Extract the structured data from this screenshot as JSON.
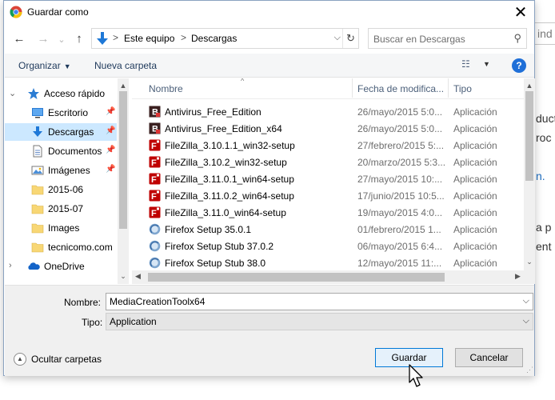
{
  "background": {
    "search_fragment": "ind",
    "text_lines": [
      "duct",
      "roc",
      "n.",
      "a p",
      "ent"
    ]
  },
  "dialog": {
    "title": "Guardar como",
    "close_glyph": "✕"
  },
  "nav": {
    "back_glyph": "←",
    "forward_glyph": "→",
    "up_glyph": "↑",
    "breadcrumbs": [
      "Este equipo",
      "Descargas"
    ],
    "breadcrumb_separator": ">",
    "address_dropdown_glyph": "⌵",
    "refresh_glyph": "↻",
    "search_placeholder": "Buscar en Descargas",
    "search_icon_glyph": "⚲"
  },
  "commandbar": {
    "organize_label": "Organizar",
    "new_folder_label": "Nueva carpeta",
    "view_glyph": "☷",
    "help_label": "?"
  },
  "navpane": {
    "items": [
      {
        "label": "Acceso rápido",
        "icon": "star-icon",
        "expander": "⌄",
        "pinned": false,
        "selected": false
      },
      {
        "label": "Escritorio",
        "icon": "desktop-icon",
        "expander": "",
        "pinned": true,
        "selected": false
      },
      {
        "label": "Descargas",
        "icon": "download-icon",
        "expander": "",
        "pinned": true,
        "selected": true
      },
      {
        "label": "Documentos",
        "icon": "documents-icon",
        "expander": "",
        "pinned": true,
        "selected": false
      },
      {
        "label": "Imágenes",
        "icon": "pictures-icon",
        "expander": "",
        "pinned": true,
        "selected": false
      },
      {
        "label": "2015-06",
        "icon": "folder-icon",
        "expander": "",
        "pinned": false,
        "selected": false
      },
      {
        "label": "2015-07",
        "icon": "folder-icon",
        "expander": "",
        "pinned": false,
        "selected": false
      },
      {
        "label": "Images",
        "icon": "folder-icon",
        "expander": "",
        "pinned": false,
        "selected": false
      },
      {
        "label": "tecnicomo.com",
        "icon": "folder-icon",
        "expander": "",
        "pinned": false,
        "selected": false
      },
      {
        "label": "OneDrive",
        "icon": "onedrive-icon",
        "expander": "›",
        "pinned": false,
        "selected": false
      }
    ]
  },
  "filelist": {
    "columns": [
      "Nombre",
      "Fecha de modifica...",
      "Tipo"
    ],
    "rows": [
      {
        "name": "Antivirus_Free_Edition",
        "date": "26/mayo/2015 5:0...",
        "type": "Aplicación",
        "icon": "antivirus-app-icon"
      },
      {
        "name": "Antivirus_Free_Edition_x64",
        "date": "26/mayo/2015 5:0...",
        "type": "Aplicación",
        "icon": "antivirus-app-icon"
      },
      {
        "name": "FileZilla_3.10.1.1_win32-setup",
        "date": "27/febrero/2015 5:...",
        "type": "Aplicación",
        "icon": "filezilla-icon"
      },
      {
        "name": "FileZilla_3.10.2_win32-setup",
        "date": "20/marzo/2015 5:3...",
        "type": "Aplicación",
        "icon": "filezilla-icon"
      },
      {
        "name": "FileZilla_3.11.0.1_win64-setup",
        "date": "27/mayo/2015 10:...",
        "type": "Aplicación",
        "icon": "filezilla-icon"
      },
      {
        "name": "FileZilla_3.11.0.2_win64-setup",
        "date": "17/junio/2015 10:5...",
        "type": "Aplicación",
        "icon": "filezilla-icon"
      },
      {
        "name": "FileZilla_3.11.0_win64-setup",
        "date": "19/mayo/2015 4:0...",
        "type": "Aplicación",
        "icon": "filezilla-icon"
      },
      {
        "name": "Firefox Setup 35.0.1",
        "date": "01/febrero/2015 1...",
        "type": "Aplicación",
        "icon": "firefox-setup-icon"
      },
      {
        "name": "Firefox Setup Stub 37.0.2",
        "date": "06/mayo/2015 6:4...",
        "type": "Aplicación",
        "icon": "firefox-setup-icon"
      },
      {
        "name": "Firefox Setup Stub 38.0",
        "date": "12/mayo/2015 11:...",
        "type": "Aplicación",
        "icon": "firefox-setup-icon"
      }
    ]
  },
  "form": {
    "name_label": "Nombre:",
    "name_value": "MediaCreationToolx64",
    "type_label": "Tipo:",
    "type_value": "Application",
    "hide_folders_label": "Ocultar carpetas",
    "save_label": "Guardar",
    "cancel_label": "Cancelar"
  },
  "colors": {
    "accent": "#0078d7",
    "selection": "#cce8ff",
    "filezilla_red": "#bf0000",
    "folder_yellow": "#f8d775"
  }
}
